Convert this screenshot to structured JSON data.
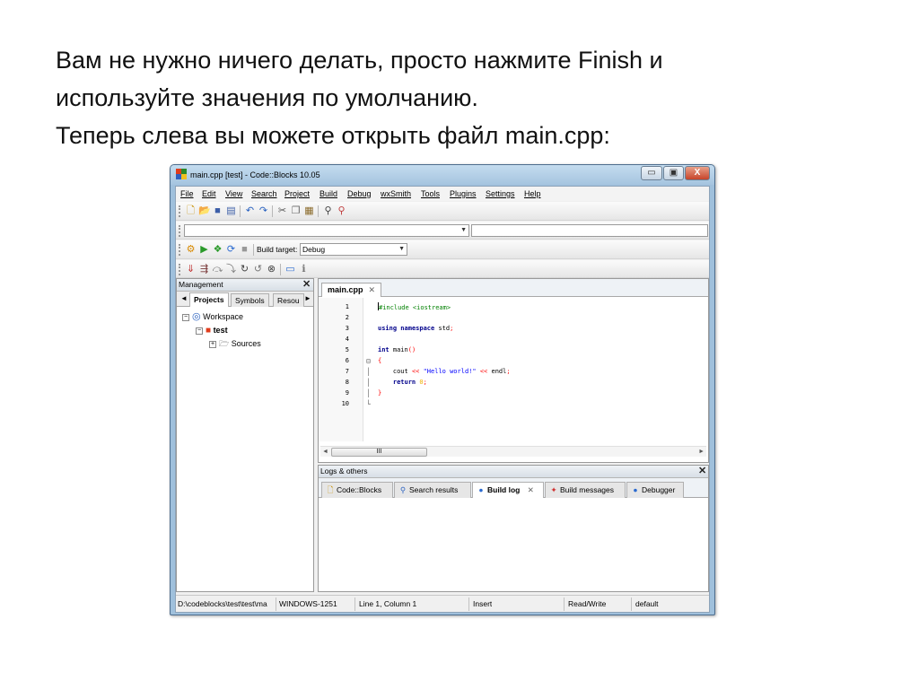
{
  "slide": {
    "lines": [
      "Вам не нужно ничего делать, просто нажмите Finish и",
      "используйте значения по умолчанию.",
      "Теперь слева вы можете открыть файл main.cpp:"
    ]
  },
  "window": {
    "title": "main.cpp [test] - Code::Blocks 10.05",
    "minimize": "▭",
    "maximize": "▣",
    "close": "X"
  },
  "menu": [
    "File",
    "Edit",
    "View",
    "Search",
    "Project",
    "Build",
    "Debug",
    "wxSmith",
    "Tools",
    "Plugins",
    "Settings",
    "Help"
  ],
  "build_toolbar": {
    "target_label": "Build target:",
    "target_value": "Debug"
  },
  "management": {
    "header": "Management",
    "close": "✕",
    "tabs": [
      "Projects",
      "Symbols",
      "Resou"
    ],
    "tree": {
      "workspace": "Workspace",
      "project": "test",
      "folder": "Sources"
    }
  },
  "editor": {
    "tab_label": "main.cpp",
    "tab_close": "✕",
    "line_numbers": [
      "1",
      "2",
      "3",
      "4",
      "5",
      "6",
      "7",
      "8",
      "9",
      "10"
    ],
    "scroll_thumb": "III"
  },
  "logs": {
    "header": "Logs & others",
    "close": "✕",
    "tabs": [
      "Code::Blocks",
      "Search results",
      "Build log",
      "Build messages",
      "Debugger"
    ],
    "tab_close": "✕"
  },
  "status": {
    "path": "D:\\codeblocks\\test\\test\\ma",
    "encoding": "WINDOWS-1251",
    "position": "Line 1, Column 1",
    "mode": "Insert",
    "access": "Read/Write",
    "lang": "default"
  },
  "colors": {
    "keyword": "#00008b",
    "preprocessor": "#008000",
    "string": "#0000ff",
    "operator": "#ff0000",
    "number": "#f0b000"
  }
}
